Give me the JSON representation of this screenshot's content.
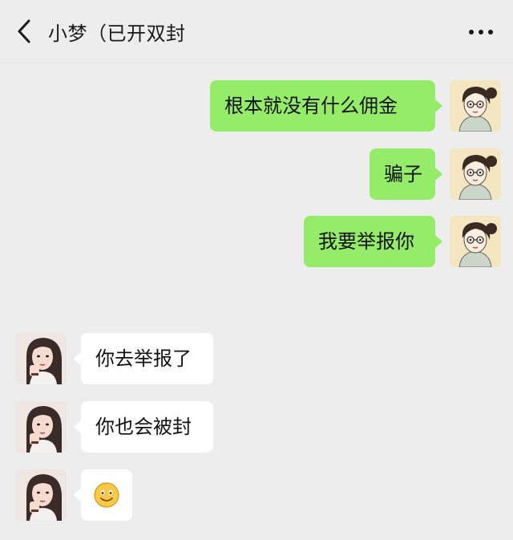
{
  "header": {
    "title": "小梦（已开双封",
    "back_icon": "chevron-left-icon",
    "more_icon": "more-dots-icon"
  },
  "messages": [
    {
      "sender": "me",
      "text": "根本就没有什么佣金"
    },
    {
      "sender": "me",
      "text": "骗子"
    },
    {
      "sender": "me",
      "text": "我要举报你"
    },
    {
      "sender": "them",
      "text": "你去举报了"
    },
    {
      "sender": "them",
      "text": "你也会被封"
    },
    {
      "sender": "them",
      "text": "",
      "emoji": "smile-emoji-icon"
    }
  ],
  "colors": {
    "background": "#ededed",
    "my_bubble": "#95ec69",
    "their_bubble": "#ffffff"
  }
}
